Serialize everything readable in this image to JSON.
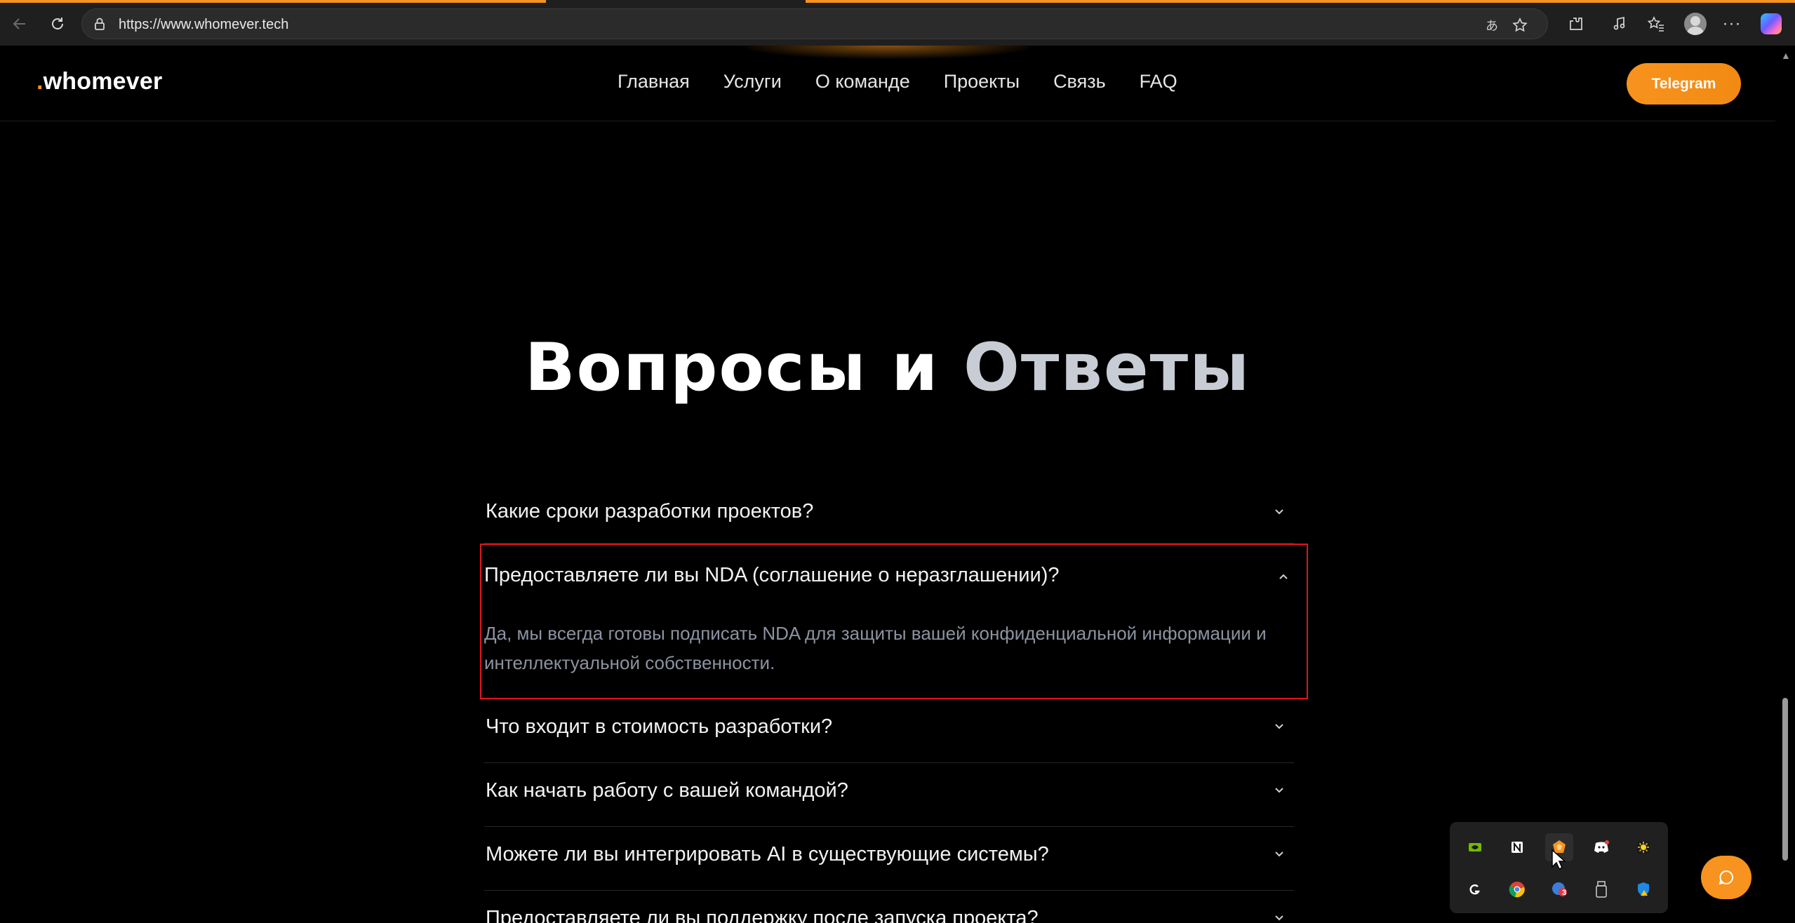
{
  "browser": {
    "url": "https://www.whomever.tech",
    "read_aloud_glyph": "あ",
    "more_glyph": "···"
  },
  "site": {
    "logo_dot": ".",
    "logo_text": "whomever",
    "nav": [
      "Главная",
      "Услуги",
      "О команде",
      "Проекты",
      "Связь",
      "FAQ"
    ],
    "cta_label": "Telegram",
    "accent_color": "#f7931e"
  },
  "faq": {
    "title_word1": "Вопросы и",
    "title_word2": "Ответы",
    "items": [
      {
        "question": "Какие сроки разработки проектов?",
        "expanded": false
      },
      {
        "question": "Предоставляете ли вы NDA (соглашение о неразглашении)?",
        "expanded": true,
        "answer": "Да, мы всегда готовы подписать NDA для защиты вашей конфиденциальной информации и интеллектуальной собственности."
      },
      {
        "question": "Что входит в стоимость разработки?",
        "expanded": false
      },
      {
        "question": "Как начать работу с вашей командой?",
        "expanded": false
      },
      {
        "question": "Можете ли вы интегрировать AI в существующие системы?",
        "expanded": false
      },
      {
        "question": "Предоставляете ли вы поддержку после запуска проекта?",
        "expanded": false
      }
    ]
  },
  "tray_icons": [
    "nvidia-icon",
    "notion-icon",
    "app-orange-icon",
    "discord-icon",
    "sun-app-icon",
    "logitech-icon",
    "chrome-icon",
    "app-red-badge-icon",
    "usb-drive-icon",
    "defender-icon"
  ],
  "tray_badge": "3"
}
